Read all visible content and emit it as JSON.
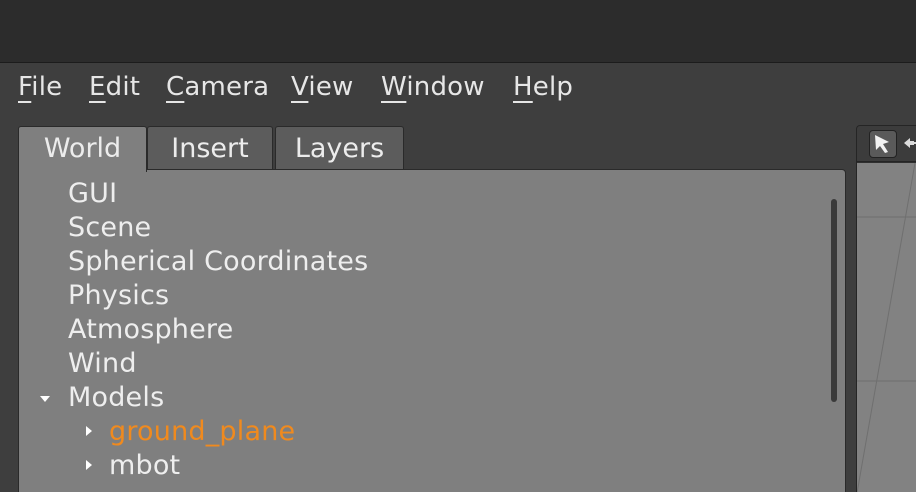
{
  "menubar": {
    "items": [
      {
        "mnemonic": "F",
        "rest": "ile"
      },
      {
        "mnemonic": "E",
        "rest": "dit"
      },
      {
        "mnemonic": "C",
        "rest": "amera"
      },
      {
        "mnemonic": "V",
        "rest": "iew"
      },
      {
        "mnemonic": "W",
        "rest": "indow"
      },
      {
        "mnemonic": "H",
        "rest": "elp"
      }
    ]
  },
  "tabs": [
    {
      "label": "World",
      "active": true
    },
    {
      "label": "Insert",
      "active": false
    },
    {
      "label": "Layers",
      "active": false
    }
  ],
  "tree": {
    "items": [
      {
        "label": "GUI",
        "expander": "none"
      },
      {
        "label": "Scene",
        "expander": "none"
      },
      {
        "label": "Spherical Coordinates",
        "expander": "none"
      },
      {
        "label": "Physics",
        "expander": "none"
      },
      {
        "label": "Atmosphere",
        "expander": "none"
      },
      {
        "label": "Wind",
        "expander": "none"
      },
      {
        "label": "Models",
        "expander": "expanded"
      },
      {
        "label": "ground_plane",
        "expander": "collapsed",
        "selected": true
      },
      {
        "label": "mbot",
        "expander": "collapsed"
      }
    ],
    "selected_color": "#f08a1e"
  },
  "scene_toolbar": {
    "tools": [
      "select-arrow-icon",
      "translate-icon"
    ]
  }
}
